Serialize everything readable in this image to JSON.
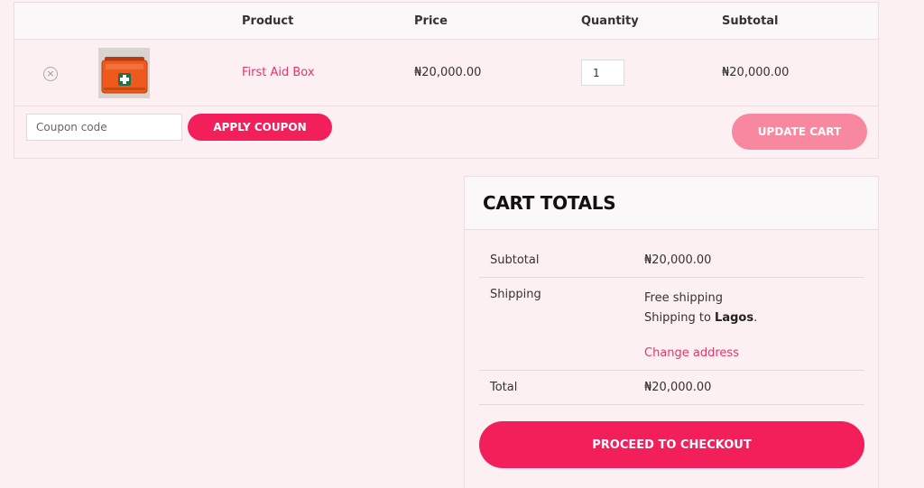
{
  "cart": {
    "headers": {
      "product": "Product",
      "price": "Price",
      "quantity": "Quantity",
      "subtotal": "Subtotal"
    },
    "items": [
      {
        "name": "First Aid Box",
        "price": "₦20,000.00",
        "quantity": "1",
        "subtotal": "₦20,000.00",
        "image_icon": "first-aid-box-image"
      }
    ],
    "remove_symbol": "×",
    "coupon_placeholder": "Coupon code",
    "apply_coupon_label": "APPLY COUPON",
    "update_cart_label": "UPDATE CART"
  },
  "totals": {
    "title": "CART TOTALS",
    "subtotal_label": "Subtotal",
    "subtotal_value": "₦20,000.00",
    "shipping_label": "Shipping",
    "shipping_method": "Free shipping",
    "shipping_to_prefix": "Shipping to ",
    "shipping_to_location": "Lagos",
    "shipping_to_suffix": ".",
    "change_address": "Change address",
    "total_label": "Total",
    "total_value": "₦20,000.00",
    "checkout_label": "PROCEED TO CHECKOUT"
  },
  "colors": {
    "accent": "#f21f5a",
    "accent_light": "#f8889f",
    "link": "#e3346c",
    "background": "#fdf0f3"
  }
}
